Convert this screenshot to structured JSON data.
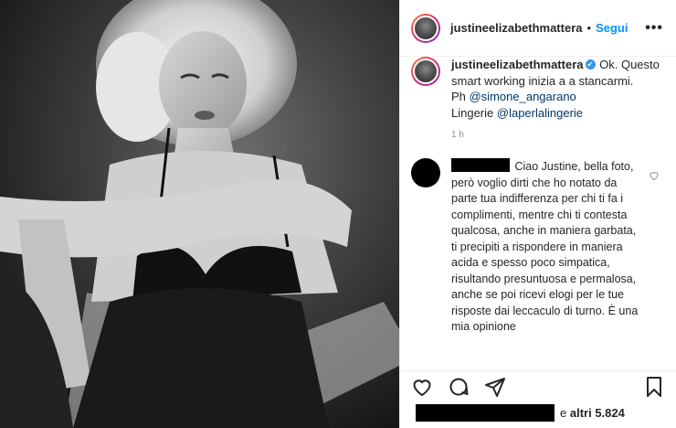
{
  "header": {
    "username": "justineelizabethmattera",
    "separator": "•",
    "follow_label": "Segui",
    "more_label": "•••"
  },
  "caption": {
    "username": "justineelizabethmattera",
    "verified_icon": "✔",
    "text1": "Ok. Questo smart working inizia a a stancarmi.",
    "ph_prefix": "Ph ",
    "ph_mention": "@simone_angarano",
    "lingerie_prefix": "Lingerie ",
    "lingerie_mention": "@laperlalingerie",
    "time": "1 h"
  },
  "comment": {
    "text": "Ciao Justine, bella foto, però voglio dirti che ho notato da parte tua indifferenza per chi ti fa i complimenti, mentre chi ti contesta qualcosa, anche in maniera garbata, ti precipiti a rispondere in maniera acida e spesso poco simpatica, risultando presuntuosa e permalosa, anche se poi ricevi elogi per le tue risposte dai leccaculo di turno. È una mia opinione"
  },
  "likes": {
    "prefix": "e ",
    "count_text": "altri 5.824"
  },
  "icons": {
    "like": "heart-icon",
    "comment": "comment-icon",
    "share": "share-icon",
    "save": "bookmark-icon",
    "more": "more-options-icon"
  },
  "colors": {
    "link": "#0095f6",
    "mention": "#00376b",
    "muted": "#8e8e8e",
    "text": "#262626"
  }
}
